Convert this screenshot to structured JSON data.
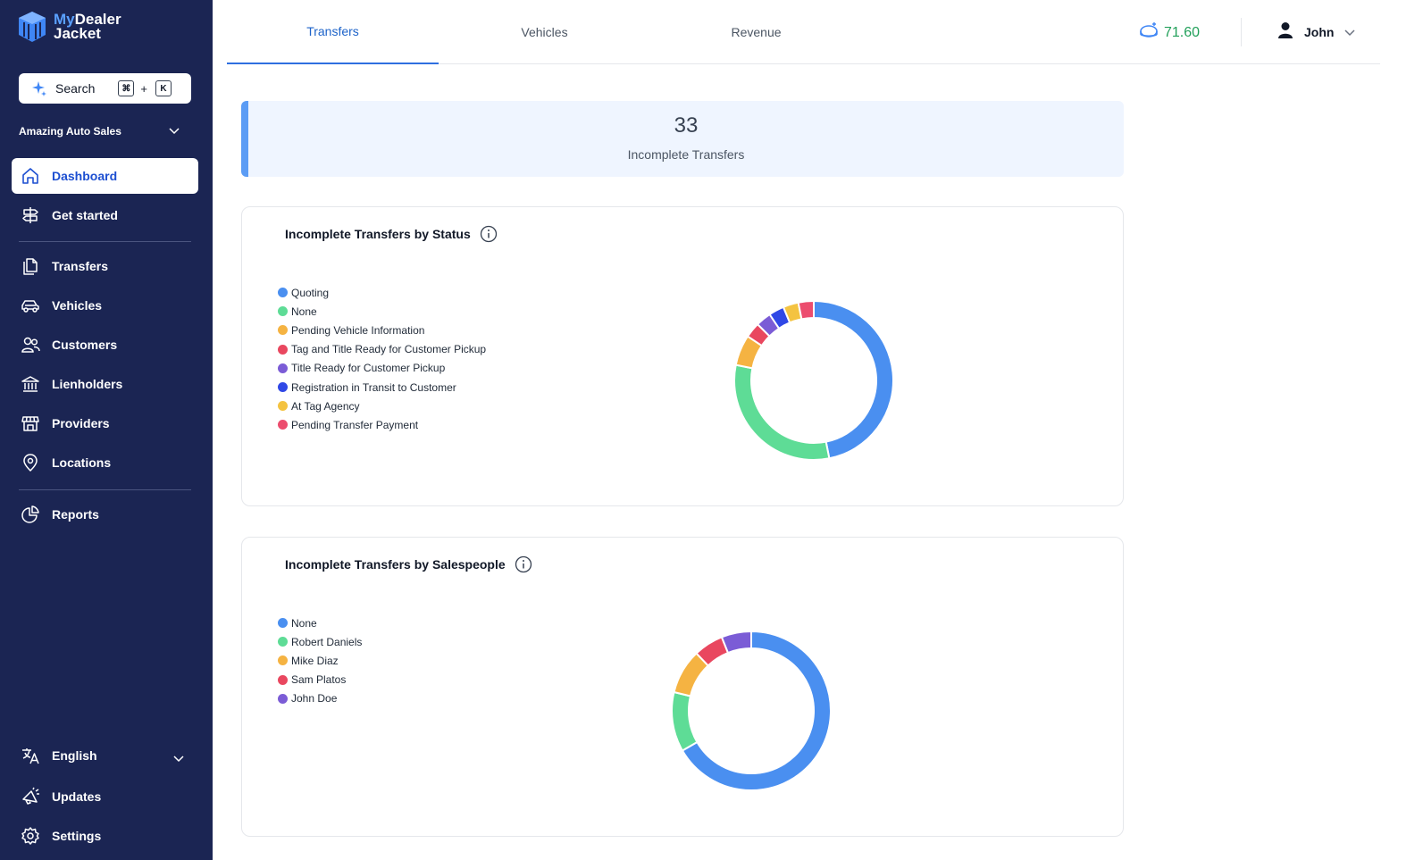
{
  "brand": {
    "name_line1_a": "My",
    "name_line1_b": "Dealer",
    "name_line2": "Jacket"
  },
  "search": {
    "label": "Search",
    "key_cmd": "⌘",
    "key_plus": "+",
    "key_k": "K"
  },
  "org": {
    "name": "Amazing Auto Sales"
  },
  "sidebar": {
    "items": [
      {
        "label": "Dashboard",
        "icon": "home-icon"
      },
      {
        "label": "Get started",
        "icon": "signpost-icon"
      },
      {
        "label": "Transfers",
        "icon": "documents-icon"
      },
      {
        "label": "Vehicles",
        "icon": "car-icon"
      },
      {
        "label": "Customers",
        "icon": "users-icon"
      },
      {
        "label": "Lienholders",
        "icon": "bank-icon"
      },
      {
        "label": "Providers",
        "icon": "storefront-icon"
      },
      {
        "label": "Locations",
        "icon": "map-pin-icon"
      },
      {
        "label": "Reports",
        "icon": "pie-chart-icon"
      }
    ],
    "footer": [
      {
        "label": "English",
        "icon": "translate-icon"
      },
      {
        "label": "Updates",
        "icon": "megaphone-icon"
      },
      {
        "label": "Settings",
        "icon": "gear-icon"
      }
    ]
  },
  "tabs": [
    {
      "label": "Transfers",
      "active": true
    },
    {
      "label": "Vehicles",
      "active": false
    },
    {
      "label": "Revenue",
      "active": false
    }
  ],
  "header": {
    "score": "71.60",
    "user_name": "John"
  },
  "kpi": {
    "value": "33",
    "label": "Incomplete Transfers"
  },
  "chart_data": [
    {
      "type": "pie",
      "title": "Incomplete Transfers by Status",
      "categories": [
        "Quoting",
        "None",
        "Pending Vehicle Information",
        "Tag and Title Ready for Customer Pickup",
        "Title Ready for Customer Pickup",
        "Registration in Transit to Customer",
        "At Tag Agency",
        "Pending Transfer Payment"
      ],
      "values": [
        15,
        10,
        2,
        1,
        1,
        1,
        1,
        1
      ],
      "colors": [
        "#4a8ff0",
        "#5edc96",
        "#f5b342",
        "#e9475f",
        "#7b5cd6",
        "#3048e6",
        "#f4c341",
        "#ec4d6e"
      ],
      "donut": true,
      "legend": "left"
    },
    {
      "type": "pie",
      "title": "Incomplete Transfers by Salespeople",
      "categories": [
        "None",
        "Robert Daniels",
        "Mike Diaz",
        "Sam Platos",
        "John Doe"
      ],
      "values": [
        22,
        4,
        3,
        2,
        2
      ],
      "colors": [
        "#4a8ff0",
        "#5edc96",
        "#f5b342",
        "#e9475f",
        "#7b5cd6"
      ],
      "donut": true,
      "legend": "left"
    }
  ]
}
